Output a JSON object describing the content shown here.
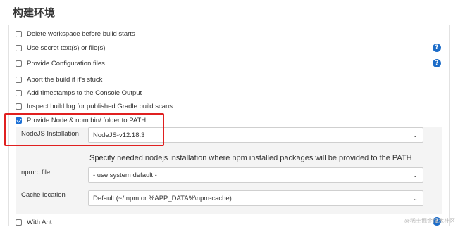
{
  "section": {
    "title": "构建环境"
  },
  "options": [
    {
      "label": "Delete workspace before build starts",
      "checked": false
    },
    {
      "label": "Use secret text(s) or file(s)",
      "checked": false
    },
    {
      "label": "Provide Configuration files",
      "checked": false
    },
    {
      "label": "Abort the build if it's stuck",
      "checked": false
    },
    {
      "label": "Add timestamps to the Console Output",
      "checked": false
    },
    {
      "label": "Inspect build log for published Gradle build scans",
      "checked": false
    },
    {
      "label": "Provide Node & npm bin/ folder to PATH",
      "checked": true
    }
  ],
  "node_panel": {
    "installation_label": "NodeJS Installation",
    "installation_value": "NodeJS-v12.18.3",
    "hint": "Specify needed nodejs installation where npm installed packages will be provided to the PATH",
    "npmrc_label": "npmrc file",
    "npmrc_value": "- use system default -",
    "cache_label": "Cache location",
    "cache_value": "Default (~/.npm or %APP_DATA%\\npm-cache)"
  },
  "last_option": {
    "label": "With Ant",
    "checked": false
  },
  "help_glyph": "?",
  "chevron_glyph": "⌄",
  "icons": [
    "help-icon",
    "chevron-down-icon",
    "checkbox-icon"
  ],
  "colors": {
    "highlight": "#e02020",
    "help": "#1c6cc8",
    "checkbox_checked": "#1a6fd6",
    "panel": "#f4f4f4"
  },
  "watermark": "@稀土掘金技术社区"
}
